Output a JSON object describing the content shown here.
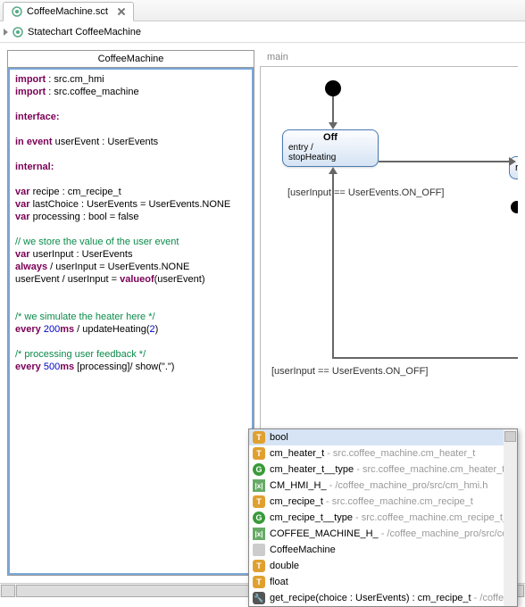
{
  "tab": {
    "filename": "CoffeeMachine.sct"
  },
  "breadcrumb": {
    "label": "Statechart CoffeeMachine"
  },
  "definition": {
    "title": "CoffeeMachine",
    "lines": [
      {
        "segments": [
          {
            "t": "import",
            "c": "kw"
          },
          {
            "t": " : src.cm_hmi"
          }
        ]
      },
      {
        "segments": [
          {
            "t": "import",
            "c": "kw"
          },
          {
            "t": " : src.coffee_machine"
          }
        ]
      },
      {
        "segments": []
      },
      {
        "segments": [
          {
            "t": "interface:",
            "c": "kw"
          }
        ]
      },
      {
        "segments": []
      },
      {
        "segments": [
          {
            "t": "in event",
            "c": "kw"
          },
          {
            "t": " userEvent : UserEvents"
          }
        ]
      },
      {
        "segments": []
      },
      {
        "segments": [
          {
            "t": "internal:",
            "c": "kw"
          }
        ]
      },
      {
        "segments": []
      },
      {
        "segments": [
          {
            "t": "var",
            "c": "kw"
          },
          {
            "t": " recipe : cm_recipe_t"
          }
        ]
      },
      {
        "segments": [
          {
            "t": "var",
            "c": "kw"
          },
          {
            "t": " lastChoice : UserEvents = UserEvents.NONE"
          }
        ]
      },
      {
        "segments": [
          {
            "t": "var",
            "c": "kw"
          },
          {
            "t": " processing : bool = false"
          }
        ]
      },
      {
        "segments": []
      },
      {
        "segments": [
          {
            "t": "// we store the value of the user event",
            "c": "cmt"
          }
        ]
      },
      {
        "segments": [
          {
            "t": "var",
            "c": "kw"
          },
          {
            "t": " userInput : UserEvents"
          }
        ]
      },
      {
        "segments": [
          {
            "t": "always",
            "c": "kw"
          },
          {
            "t": " / userInput = UserEvents.NONE"
          }
        ]
      },
      {
        "segments": [
          {
            "t": "userEvent / userInput = "
          },
          {
            "t": "valueof",
            "c": "kw"
          },
          {
            "t": "(userEvent)"
          }
        ]
      },
      {
        "segments": []
      },
      {
        "segments": []
      },
      {
        "segments": [
          {
            "t": "/* we simulate the heater here */",
            "c": "cmt"
          }
        ]
      },
      {
        "segments": [
          {
            "t": "every",
            "c": "kw"
          },
          {
            "t": " "
          },
          {
            "t": "200",
            "c": "num"
          },
          {
            "t": "ms",
            "c": "kw"
          },
          {
            "t": " / updateHeating("
          },
          {
            "t": "2",
            "c": "num"
          },
          {
            "t": ")"
          }
        ]
      },
      {
        "segments": []
      },
      {
        "segments": [
          {
            "t": "/* processing user feedback  */",
            "c": "cmt"
          }
        ]
      },
      {
        "segments": [
          {
            "t": "every",
            "c": "kw"
          },
          {
            "t": " "
          },
          {
            "t": "500",
            "c": "num"
          },
          {
            "t": "ms",
            "c": "kw"
          },
          {
            "t": " [processing]/ show(\".\")"
          }
        ]
      }
    ]
  },
  "diagram": {
    "region": "main",
    "state_off": {
      "name": "Off",
      "entry": "entry /",
      "action": "stopHeating"
    },
    "guard1": "[userInput == UserEvents.ON_OFF]",
    "guard2": "[userInput == UserEvents.ON_OFF]",
    "cutoff_text": "r"
  },
  "autocomplete": {
    "items": [
      {
        "icon": "t",
        "label": "bool",
        "hint": "",
        "selected": true
      },
      {
        "icon": "t",
        "label": "cm_heater_t",
        "hint": " - src.coffee_machine.cm_heater_t"
      },
      {
        "icon": "g",
        "label": "cm_heater_t__type",
        "hint": " - src.coffee_machine.cm_heater_t__typ"
      },
      {
        "icon": "x",
        "label": "CM_HMI_H_",
        "hint": " - /coffee_machine_pro/src/cm_hmi.h"
      },
      {
        "icon": "t",
        "label": "cm_recipe_t",
        "hint": " - src.coffee_machine.cm_recipe_t"
      },
      {
        "icon": "g",
        "label": "cm_recipe_t__type",
        "hint": " - src.coffee_machine.cm_recipe_t__typ"
      },
      {
        "icon": "x",
        "label": "COFFEE_MACHINE_H_",
        "hint": " - /coffee_machine_pro/src/coffee_…"
      },
      {
        "icon": "sq",
        "label": "CoffeeMachine",
        "hint": ""
      },
      {
        "icon": "t",
        "label": "double",
        "hint": ""
      },
      {
        "icon": "t",
        "label": "float",
        "hint": ""
      },
      {
        "icon": "w",
        "label": "get_recipe(choice : UserEvents) : cm_recipe_t",
        "hint": " - /coffee_m…"
      }
    ]
  }
}
